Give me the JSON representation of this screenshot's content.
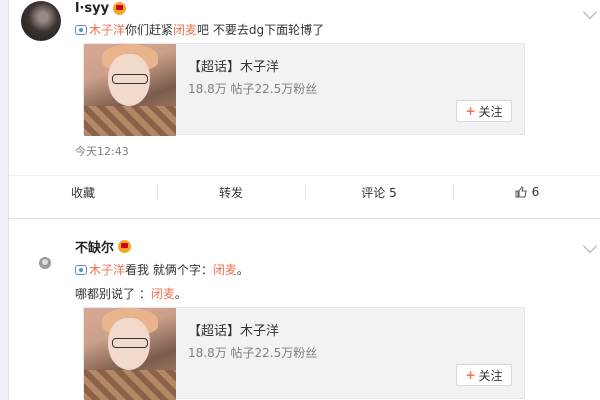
{
  "posts": [
    {
      "username": "l·syy",
      "content_parts": [
        "木子洋",
        "你们赶紧",
        "闭麦",
        "吧 不要去dg下面轮博了"
      ],
      "embed": {
        "title": "【超话】木子洋",
        "stats": "18.8万 帖子22.5万粉丝",
        "follow_label": "关注"
      },
      "timestamp": "今天12:43",
      "actions": {
        "favorite": "收藏",
        "repost": "转发",
        "comment": "评论 5",
        "like_count": "6"
      }
    },
    {
      "username": "不缺尔",
      "line1_parts": [
        "木子洋",
        "看我 就俩个字：",
        "闭麦",
        "。"
      ],
      "line2_parts": [
        "哪都别说了 ：",
        "闭麦",
        "。"
      ],
      "embed": {
        "title": "【超话】木子洋",
        "stats": "18.8万 帖子22.5万粉丝",
        "follow_label": "关注"
      }
    }
  ],
  "colors": {
    "accent": "#eb7350",
    "text": "#333333",
    "muted": "#808080"
  },
  "icons": [
    "crown-badge-icon",
    "super-topic-icon",
    "plus-icon",
    "thumbs-up-icon",
    "chevron-down-icon"
  ]
}
